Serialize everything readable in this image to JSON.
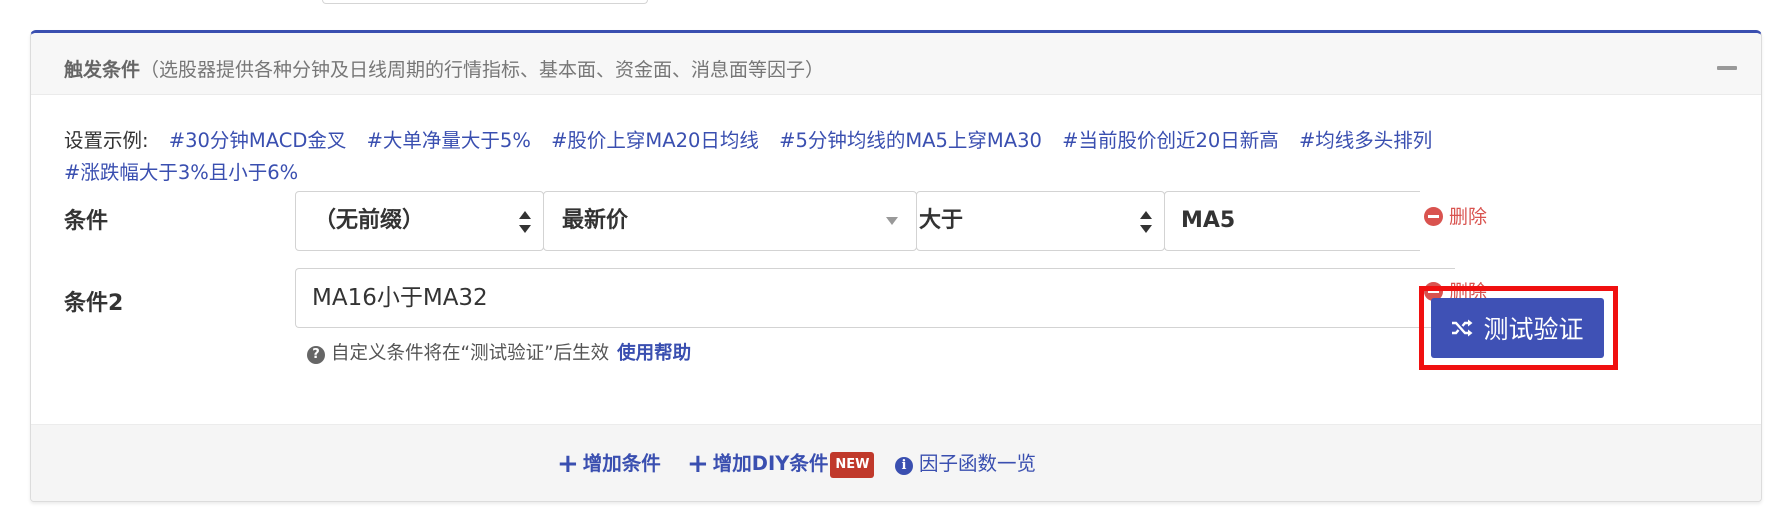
{
  "card": {
    "title_bold": "触发条件",
    "title_note": "（选股器提供各种分钟及日线周期的行情指标、基本面、资金面、消息面等因子）"
  },
  "examples": {
    "label": "设置示例:",
    "tags": [
      "#30分钟MACD金叉",
      "#大单净量大于5%",
      "#股价上穿MA20日均线",
      "#5分钟均线的MA5上穿MA30",
      "#当前股价创近20日新高",
      "#均线多头排列",
      "#涨跌幅大于3%且小于6%"
    ]
  },
  "condition1": {
    "label": "条件",
    "prefix": "（无前缀）",
    "indicator": "最新价",
    "operator": "大于",
    "value": "MA5",
    "delete_label": "删除"
  },
  "condition2": {
    "label": "条件2",
    "value": "MA16小于MA32",
    "test_button": "测试验证",
    "delete_label": "删除",
    "hint": "自定义条件将在“测试验证”后生效",
    "help_link": "使用帮助"
  },
  "footer": {
    "add_condition": "增加条件",
    "add_diy_condition": "增加DIY条件",
    "new_badge": "NEW",
    "factor_list": "因子函数一览"
  },
  "colors": {
    "primary": "#3f51b5",
    "link": "#3a4fb0",
    "danger": "#d9534f",
    "highlight": "#f01010"
  }
}
